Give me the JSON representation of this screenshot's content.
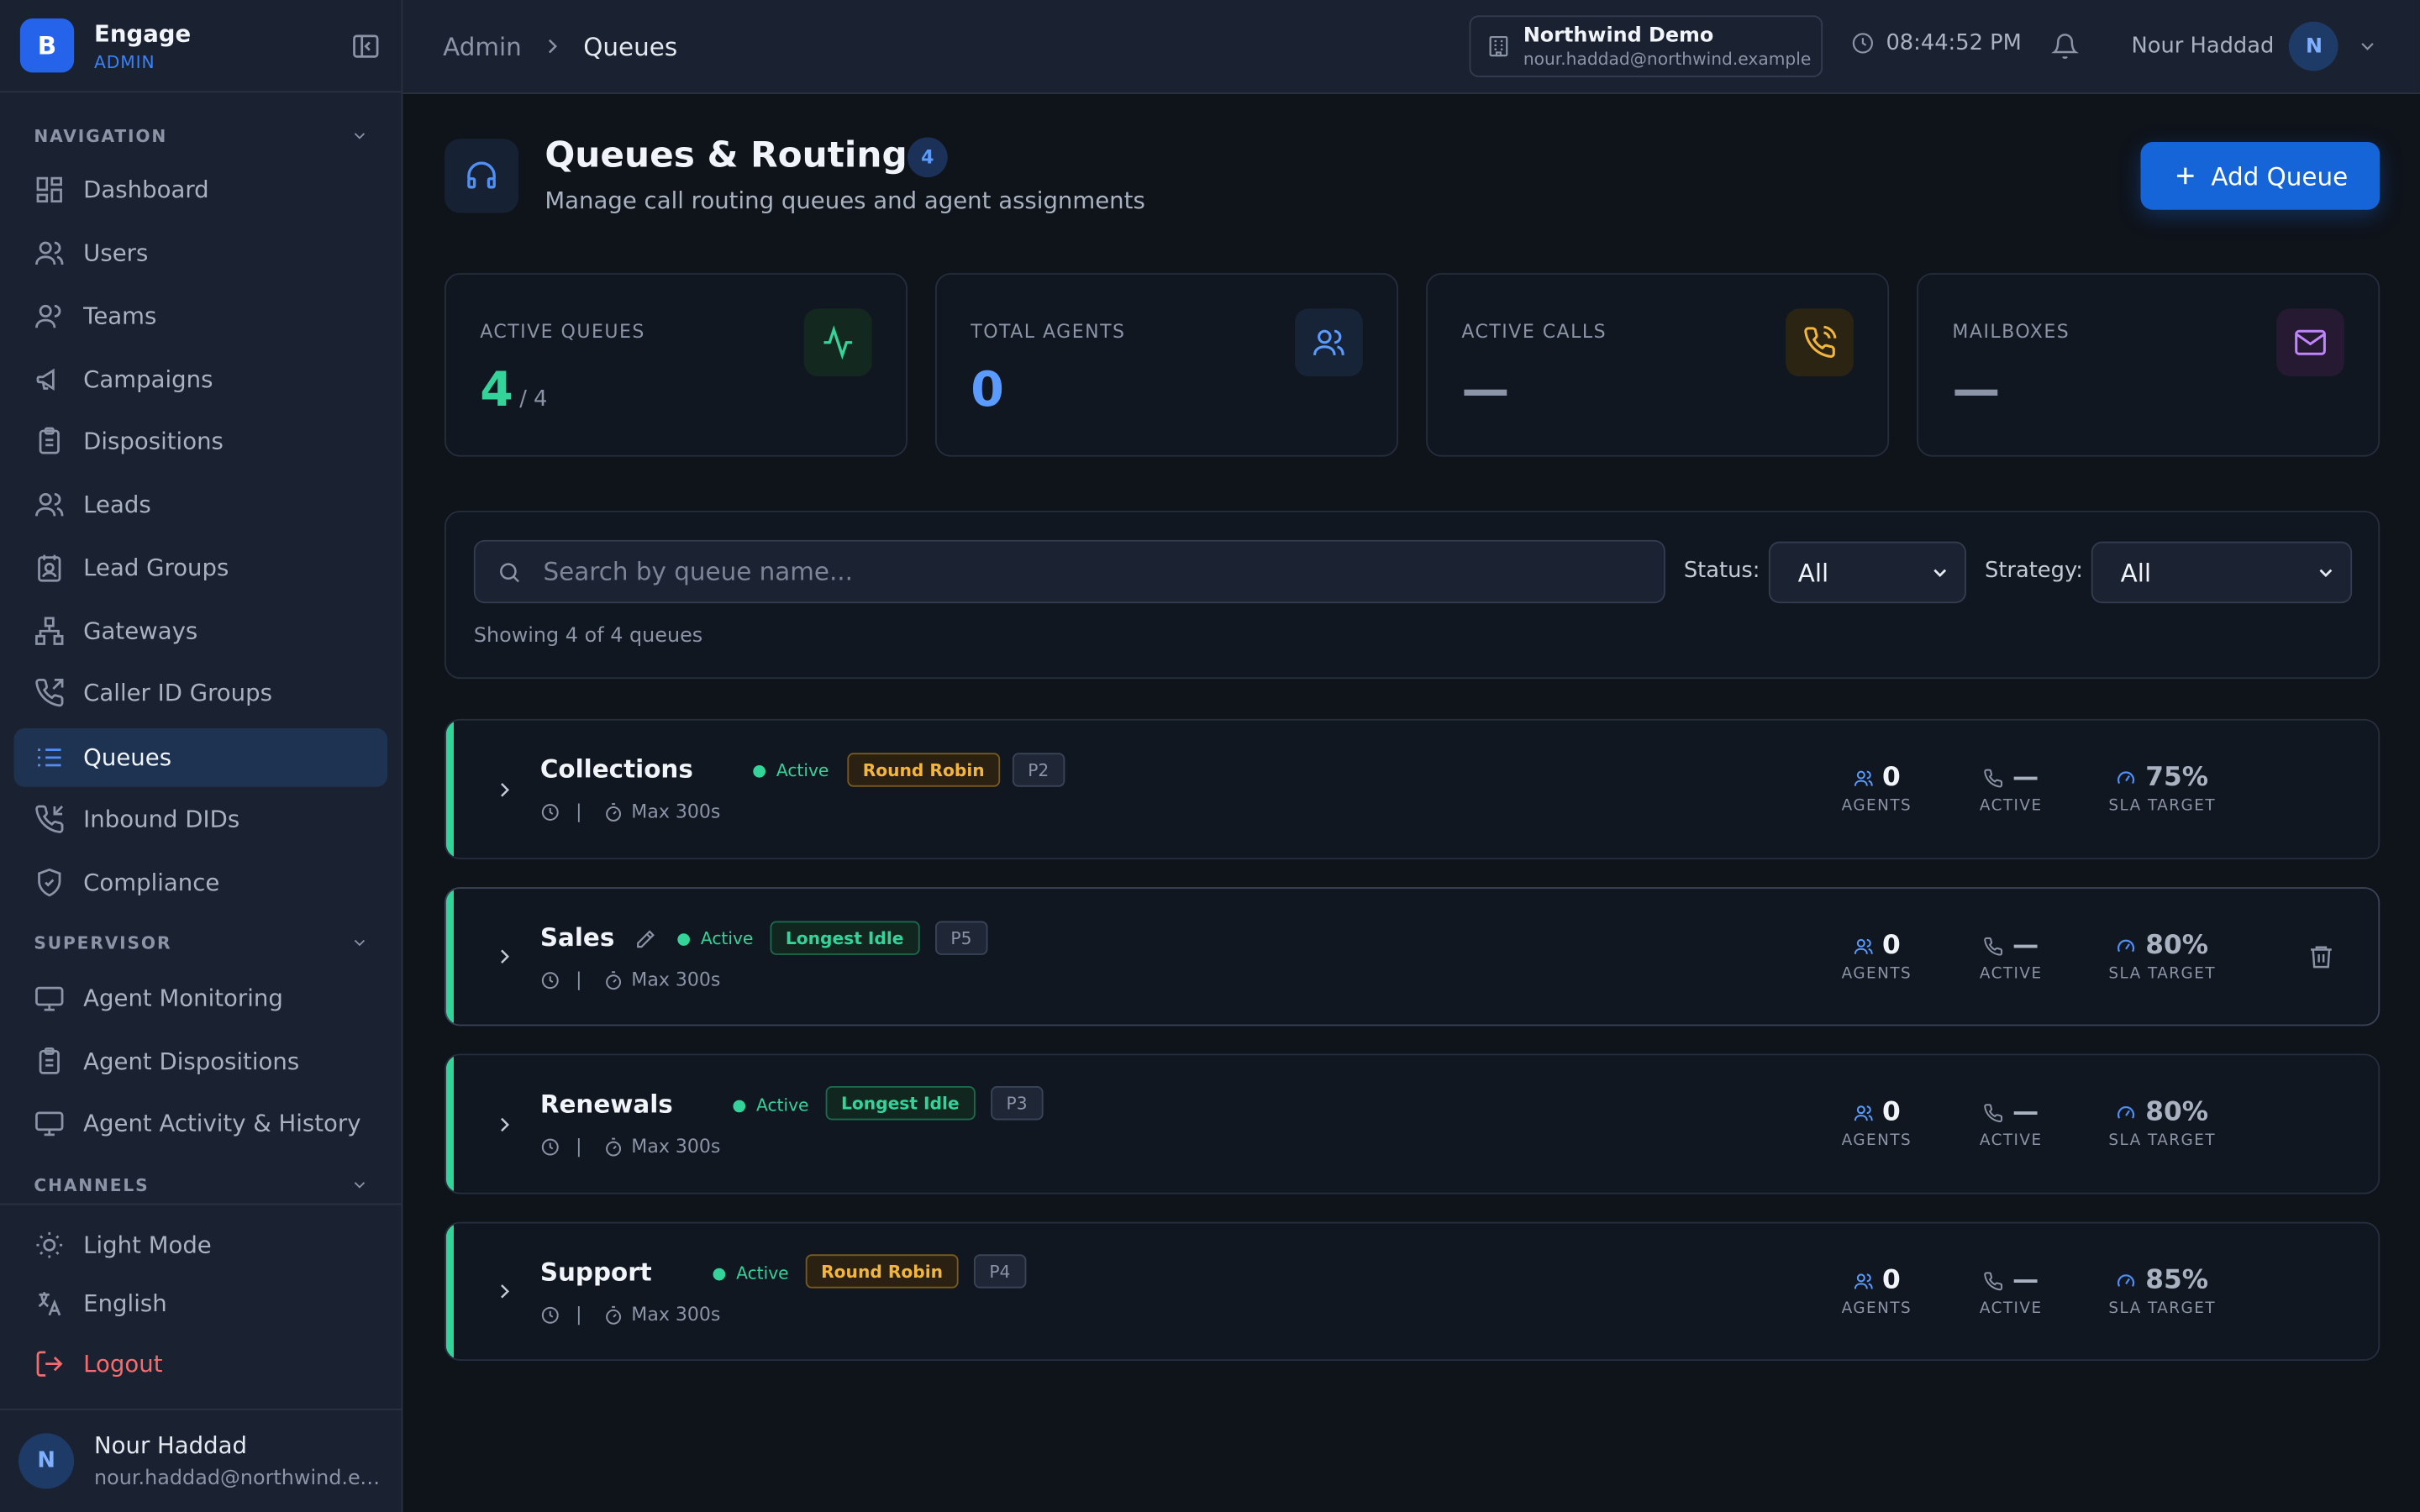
{
  "brand": {
    "logo_letter": "B",
    "name": "Engage",
    "role": "ADMIN"
  },
  "sidebar": {
    "sections": [
      {
        "label": "NAVIGATION"
      },
      {
        "label": "SUPERVISOR"
      },
      {
        "label": "CHANNELS"
      }
    ],
    "nav_items": [
      {
        "label": "Dashboard",
        "icon": "dashboard-icon"
      },
      {
        "label": "Users",
        "icon": "users-icon"
      },
      {
        "label": "Teams",
        "icon": "teams-icon"
      },
      {
        "label": "Campaigns",
        "icon": "megaphone-icon"
      },
      {
        "label": "Dispositions",
        "icon": "clipboard-icon"
      },
      {
        "label": "Leads",
        "icon": "leads-icon"
      },
      {
        "label": "Lead Groups",
        "icon": "contact-book-icon"
      },
      {
        "label": "Gateways",
        "icon": "network-icon"
      },
      {
        "label": "Caller ID Groups",
        "icon": "phone-outgoing-icon"
      },
      {
        "label": "Queues",
        "icon": "list-icon"
      },
      {
        "label": "Inbound DIDs",
        "icon": "phone-incoming-icon"
      },
      {
        "label": "Compliance",
        "icon": "shield-check-icon"
      }
    ],
    "supervisor_items": [
      {
        "label": "Agent Monitoring",
        "icon": "monitor-icon"
      },
      {
        "label": "Agent Dispositions",
        "icon": "clipboard-icon"
      },
      {
        "label": "Agent Activity & History",
        "icon": "monitor-icon"
      }
    ],
    "footer_items": [
      {
        "label": "Light Mode",
        "icon": "sun-icon"
      },
      {
        "label": "English",
        "icon": "translate-icon"
      },
      {
        "label": "Logout",
        "icon": "logout-icon"
      }
    ],
    "user": {
      "initial": "N",
      "name": "Nour Haddad",
      "email": "nour.haddad@northwind.example"
    }
  },
  "header": {
    "breadcrumb": [
      "Admin",
      "Queues"
    ],
    "tenant": {
      "name": "Northwind Demo",
      "email": "nour.haddad@northwind.example"
    },
    "time": "08:44:52 PM",
    "user": {
      "name": "Nour Haddad",
      "initial": "N"
    }
  },
  "page": {
    "title": "Queues & Routing",
    "count": "4",
    "subtitle": "Manage call routing queues and agent assignments",
    "add_button": "Add Queue"
  },
  "stats": [
    {
      "label": "ACTIVE QUEUES",
      "value": "4",
      "sub": "/ 4",
      "color": "#34d399",
      "icon": "activity-icon"
    },
    {
      "label": "TOTAL AGENTS",
      "value": "0",
      "sub": "",
      "color": "#5b9bff",
      "icon": "users-icon"
    },
    {
      "label": "ACTIVE CALLS",
      "value": "—",
      "sub": "",
      "color": "#8a94a6",
      "icon": "phone-call-icon"
    },
    {
      "label": "MAILBOXES",
      "value": "—",
      "sub": "",
      "color": "#8a94a6",
      "icon": "mail-icon"
    }
  ],
  "filters": {
    "search_placeholder": "Search by queue name...",
    "status_label": "Status:",
    "status_value": "All",
    "strategy_label": "Strategy:",
    "strategy_value": "All",
    "showing": "Showing 4 of 4 queues"
  },
  "queues": [
    {
      "name": "Collections",
      "status": "Active",
      "strategy": "Round Robin",
      "priority": "P2",
      "max": "Max 300s",
      "agents": "0",
      "active": "—",
      "sla": "75%"
    },
    {
      "name": "Sales",
      "status": "Active",
      "strategy": "Longest Idle",
      "priority": "P5",
      "max": "Max 300s",
      "agents": "0",
      "active": "—",
      "sla": "80%"
    },
    {
      "name": "Renewals",
      "status": "Active",
      "strategy": "Longest Idle",
      "priority": "P3",
      "max": "Max 300s",
      "agents": "0",
      "active": "—",
      "sla": "80%"
    },
    {
      "name": "Support",
      "status": "Active",
      "strategy": "Round Robin",
      "priority": "P4",
      "max": "Max 300s",
      "agents": "0",
      "active": "—",
      "sla": "85%"
    }
  ],
  "metric_labels": {
    "agents": "AGENTS",
    "active": "ACTIVE",
    "sla": "SLA TARGET"
  }
}
